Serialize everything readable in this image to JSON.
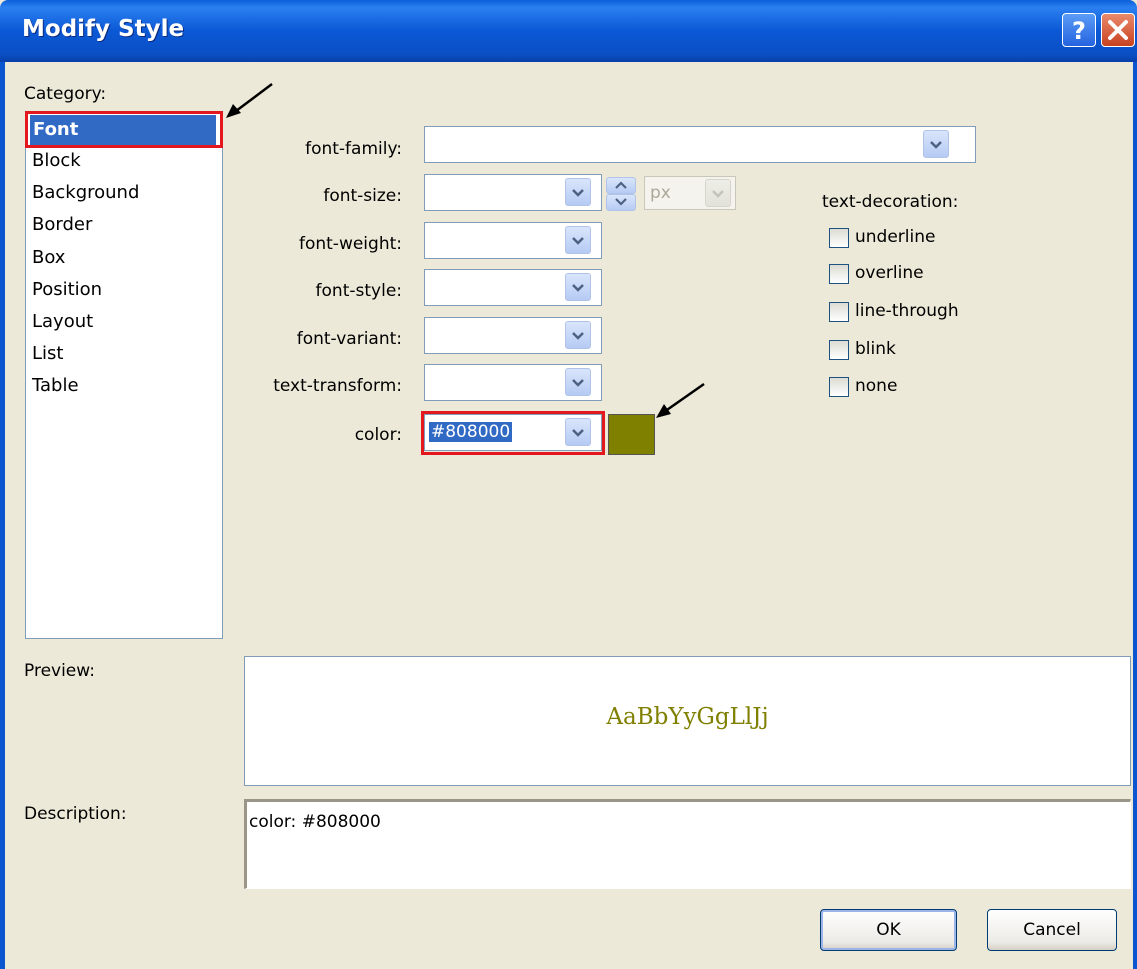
{
  "window": {
    "title": "Modify Style",
    "help_icon": "help-icon",
    "close_icon": "close-icon"
  },
  "category": {
    "label": "Category:",
    "items": [
      "Font",
      "Block",
      "Background",
      "Border",
      "Box",
      "Position",
      "Layout",
      "List",
      "Table"
    ],
    "selected": "Font"
  },
  "font": {
    "family": {
      "label": "font-family:",
      "value": ""
    },
    "size": {
      "label": "font-size:",
      "value": "",
      "unit": "px"
    },
    "weight": {
      "label": "font-weight:",
      "value": ""
    },
    "style": {
      "label": "font-style:",
      "value": ""
    },
    "variant": {
      "label": "font-variant:",
      "value": ""
    },
    "transform": {
      "label": "text-transform:",
      "value": ""
    },
    "color": {
      "label": "color:",
      "value": "#808000",
      "swatch": "#808000"
    }
  },
  "text_decoration": {
    "label": "text-decoration:",
    "options": [
      {
        "label": "underline",
        "checked": false
      },
      {
        "label": "overline",
        "checked": false
      },
      {
        "label": "line-through",
        "checked": false
      },
      {
        "label": "blink",
        "checked": false
      },
      {
        "label": "none",
        "checked": false
      }
    ]
  },
  "preview": {
    "label": "Preview:",
    "sample": "AaBbYyGgLlJj",
    "color": "#808000"
  },
  "description": {
    "label": "Description:",
    "text": "color: #808000"
  },
  "buttons": {
    "ok": "OK",
    "cancel": "Cancel"
  },
  "annotations": {
    "highlight_color": "#e3171e"
  }
}
